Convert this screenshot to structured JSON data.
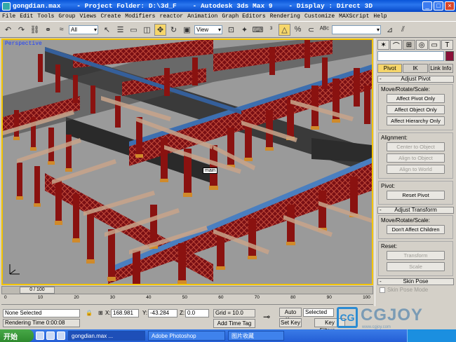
{
  "window": {
    "title": "gongdian.max    - Project Folder: D:\\3d_F    - Autodesk 3ds Max 9    - Display : Direct 3D",
    "buttons": [
      "_",
      "□",
      "×"
    ]
  },
  "menu": [
    "File",
    "Edit",
    "Tools",
    "Group",
    "Views",
    "Create",
    "Modifiers",
    "reactor",
    "Animation",
    "Graph Editors",
    "Rendering",
    "Customize",
    "MAXScript",
    "Help"
  ],
  "toolbar": {
    "selection_filter": "All",
    "ref_coord": "View",
    "active_tool": "move"
  },
  "viewport": {
    "label": "Perspective",
    "object_tag": "main",
    "axis": "z x y"
  },
  "command_panel": {
    "subtabs": [
      "Pivot",
      "IK",
      "Link Info"
    ],
    "active_subtab": "Pivot",
    "adjust_pivot": {
      "title": "Adjust Pivot",
      "move_group": "Move/Rotate/Scale:",
      "move_buttons": [
        "Affect Pivot Only",
        "Affect Object Only",
        "Affect Hierarchy Only"
      ],
      "align_group": "Alignment:",
      "align_buttons": [
        "Center to Object",
        "Align to Object",
        "Align to World"
      ],
      "pivot_group": "Pivot:",
      "reset_pivot": "Reset Pivot"
    },
    "adjust_transform": {
      "title": "Adjust Transform",
      "move_group": "Move/Rotate/Scale:",
      "dont_affect": "Don't Affect Children",
      "reset_group": "Reset:",
      "reset_buttons": [
        "Transform",
        "Scale"
      ]
    },
    "skin_pose": {
      "title": "Skin Pose",
      "mode": "Skin Pose Mode"
    }
  },
  "timeline": {
    "frame": "0 / 100",
    "ticks": [
      "0",
      "10",
      "20",
      "30",
      "40",
      "50",
      "60",
      "70",
      "80",
      "90",
      "100"
    ]
  },
  "status": {
    "selection": "None Selected",
    "x_label": "X:",
    "x": "168.981",
    "y_label": "Y:",
    "y": "-43.284",
    "z_label": "Z:",
    "z": "0.0",
    "grid": "Grid = 10.0",
    "auto_key": "Auto Key",
    "selected": "Selected",
    "set_key": "Set Key",
    "key_filters": "Key Filters...",
    "render_time": "Rendering Time  0:00:08",
    "add_time_tag": "Add Time Tag"
  },
  "taskbar": {
    "start": "开始",
    "tasks": [
      "gongdian.max ...",
      "Adobe Photoshop",
      "图片收藏"
    ],
    "active_task": 0
  },
  "watermark": {
    "badge": "CG",
    "text": "CGJOY",
    "url": "www.cgjoy.com"
  }
}
